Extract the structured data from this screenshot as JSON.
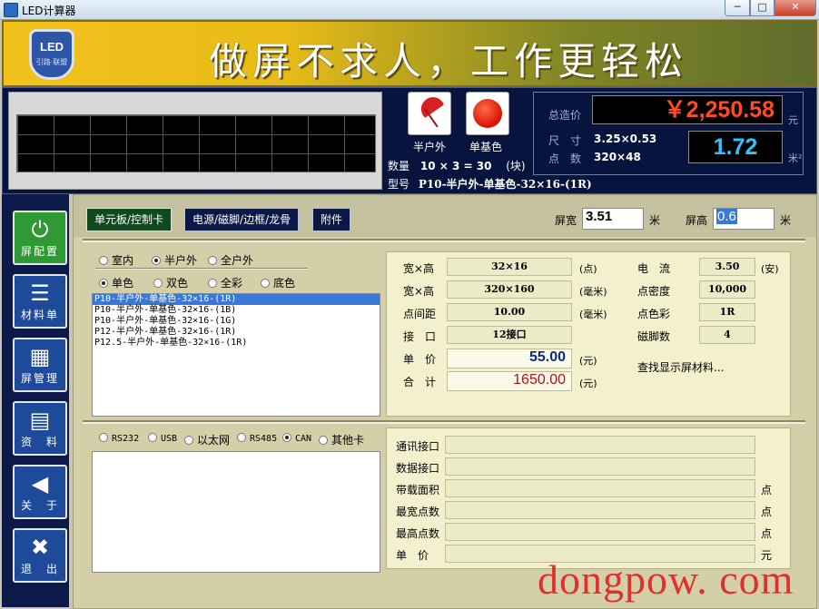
{
  "window": {
    "title": "LED计算器",
    "min": "─",
    "max": "□",
    "close": "✕"
  },
  "banner": {
    "logo_text": "LED",
    "logo_sub": "引路·联盟",
    "slogan": "做屏不求人，工作更轻松"
  },
  "summary": {
    "mode_outdoor": "半户外",
    "mode_mono": "单基色",
    "qty_label": "数量",
    "qty_value": "10 × 3 = 30",
    "qty_unit": "(块)",
    "model_label": "型号",
    "model_value": "P10-半户外-单基色-32×16-(1R)",
    "total_label": "总造价",
    "total_price": "￥2,250.58",
    "total_unit": "元",
    "size_label": "尺　寸",
    "size_value": "3.25×0.53",
    "dots_label": "点　数",
    "dots_value": "320×48",
    "area_value": "1.72",
    "area_unit": "米²"
  },
  "sidebar": {
    "config": "屏配置",
    "material": "材料单",
    "screens": "屏管理",
    "info": "资　料",
    "about": "关　于",
    "exit": "退　出"
  },
  "tabs": {
    "board": "单元板/控制卡",
    "power": "电源/磁脚/边框/龙骨",
    "attach": "附件"
  },
  "screen": {
    "width_label": "屏宽",
    "width_value": "3.51",
    "width_unit": "米",
    "height_label": "屏高",
    "height_value": "0.6",
    "height_unit": "米"
  },
  "env_options": [
    "室内",
    "半户外",
    "全户外"
  ],
  "color_options": [
    "单色",
    "双色",
    "全彩",
    "底色"
  ],
  "products": [
    "P10-半户外-单基色-32×16-(1R)",
    "P10-半户外-单基色-32×16-(1B)",
    "P10-半户外-单基色-32×16-(1G)",
    "P12-半户外-单基色-32×16-(1R)",
    "P12.5-半户外-单基色-32×16-(1R)"
  ],
  "spec": {
    "wh_dots_label": "宽×高",
    "wh_dots_value": "32×16",
    "wh_dots_unit": "(点)",
    "wh_mm_label": "宽×高",
    "wh_mm_value": "320×160",
    "wh_mm_unit": "(毫米)",
    "pitch_label": "点间距",
    "pitch_value": "10.00",
    "pitch_unit": "(毫米)",
    "port_label": "接　口",
    "port_value": "12接口",
    "price_label": "单　价",
    "price_value": "55.00",
    "price_unit": "(元)",
    "total_label": "合　计",
    "total_value": "1650.00",
    "total_unit": "(元)",
    "current_label": "电　流",
    "current_value": "3.50",
    "current_unit": "(安)",
    "density_label": "点密度",
    "density_value": "10,000",
    "dotcolor_label": "点色彩",
    "dotcolor_value": "1R",
    "magnet_label": "磁脚数",
    "magnet_value": "4",
    "find_link": "查找显示屏材料..."
  },
  "comm_options": [
    "RS232",
    "USB",
    "以太网",
    "RS485",
    "CAN",
    "其他卡"
  ],
  "comm": {
    "port_label": "通讯接口",
    "data_label": "数据接口",
    "load_label": "带载面积",
    "load_unit": "点",
    "wide_label": "最宽点数",
    "wide_unit": "点",
    "high_label": "最高点数",
    "high_unit": "点",
    "price_label": "单　价",
    "price_unit": "元"
  },
  "watermark": "dongpow. com"
}
